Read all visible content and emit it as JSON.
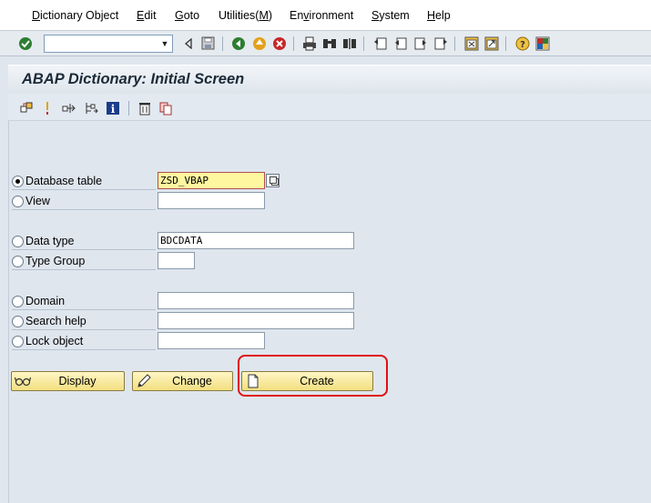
{
  "menu": {
    "items": [
      {
        "pre": "",
        "u": "D",
        "post": "ictionary Object"
      },
      {
        "pre": "",
        "u": "E",
        "post": "dit"
      },
      {
        "pre": "",
        "u": "G",
        "post": "oto"
      },
      {
        "pre": "Utilities(",
        "u": "M",
        "post": ")"
      },
      {
        "pre": "En",
        "u": "v",
        "post": "ironment"
      },
      {
        "pre": "",
        "u": "S",
        "post": "ystem"
      },
      {
        "pre": "",
        "u": "H",
        "post": "elp"
      }
    ]
  },
  "toolbar": {
    "command_value": ""
  },
  "screen": {
    "title": "ABAP Dictionary: Initial Screen"
  },
  "form": {
    "database_table": {
      "label": "Database table",
      "value": "ZSD_VBAP",
      "selected": true
    },
    "view": {
      "label": "View",
      "value": ""
    },
    "data_type": {
      "label": "Data type",
      "value": "BDCDATA"
    },
    "type_group": {
      "label": "Type Group",
      "value": ""
    },
    "domain": {
      "label": "Domain",
      "value": ""
    },
    "search_help": {
      "label": "Search help",
      "value": ""
    },
    "lock_object": {
      "label": "Lock object",
      "value": ""
    }
  },
  "buttons": {
    "display": "Display",
    "change": "Change",
    "create": "Create"
  },
  "colors": {
    "accent_highlight": "#e01010",
    "button_fill": "#f2df80",
    "focus_field": "#fff6a0"
  }
}
